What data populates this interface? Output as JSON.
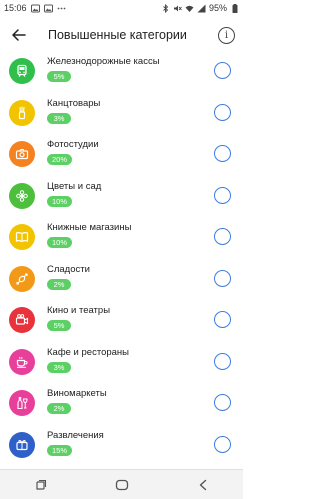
{
  "status_bar": {
    "time": "15:06",
    "battery": "95%",
    "left_icons": [
      "image-icon",
      "image-icon",
      "more-dots-icon"
    ],
    "right_icons": [
      "bluetooth-icon",
      "mute-icon",
      "wifi-icon",
      "signal-icon",
      "battery-icon"
    ]
  },
  "header": {
    "title": "Повышенные категории",
    "info_glyph": "i"
  },
  "categories": [
    {
      "name": "Железнодорожные кассы",
      "rate": "5%",
      "icon": "train-icon",
      "color": "#2fbf4a"
    },
    {
      "name": "Канцтовары",
      "rate": "3%",
      "icon": "pencils-icon",
      "color": "#f2c400"
    },
    {
      "name": "Фотостудии",
      "rate": "20%",
      "icon": "camera-icon",
      "color": "#f58220"
    },
    {
      "name": "Цветы и сад",
      "rate": "10%",
      "icon": "flower-icon",
      "color": "#4cbf3c"
    },
    {
      "name": "Книжные магазины",
      "rate": "10%",
      "icon": "book-icon",
      "color": "#f2c400"
    },
    {
      "name": "Сладости",
      "rate": "2%",
      "icon": "candy-icon",
      "color": "#f29a18"
    },
    {
      "name": "Кино и театры",
      "rate": "5%",
      "icon": "cinema-icon",
      "color": "#e8323c"
    },
    {
      "name": "Кафе и рестораны",
      "rate": "3%",
      "icon": "coffee-cup-icon",
      "color": "#e8409a"
    },
    {
      "name": "Виномаркеты",
      "rate": "2%",
      "icon": "wine-bottle-icon",
      "color": "#e8409a"
    },
    {
      "name": "Развлечения",
      "rate": "15%",
      "icon": "entertainment-icon",
      "color": "#2f5fc8"
    }
  ],
  "colors": {
    "badge": "#5cd064",
    "radio": "#3c7de0"
  },
  "nav_bar": {
    "icons": [
      "recent-apps-icon",
      "home-icon",
      "back-icon"
    ]
  }
}
